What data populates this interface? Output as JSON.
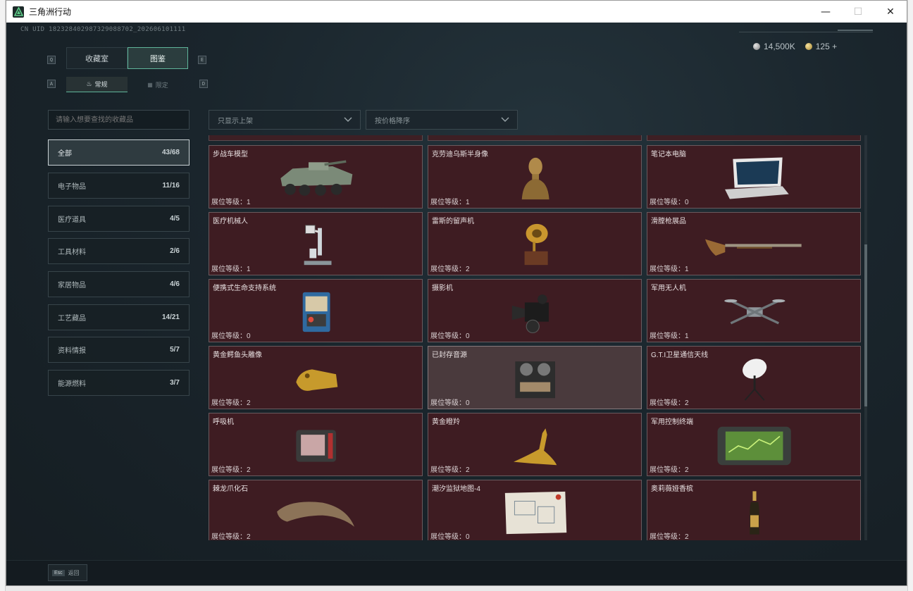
{
  "window": {
    "title": "三角洲行动"
  },
  "header": {
    "uid": "CN UID 182328402987329088702_202606101111",
    "currency": [
      {
        "icon": "silver-coin-icon",
        "value": "14,500K"
      },
      {
        "icon": "gold-coin-icon",
        "value": "125 +"
      }
    ]
  },
  "tabs": [
    {
      "label": "收藏室",
      "active": false
    },
    {
      "label": "图鉴",
      "active": true
    }
  ],
  "tab_keys": [
    "Q",
    "E"
  ],
  "subtabs": [
    {
      "label": "常规",
      "active": true
    },
    {
      "label": "限定",
      "active": false
    }
  ],
  "subtab_keys": [
    "A",
    "D"
  ],
  "search": {
    "placeholder": "请输入想要查找的收藏品"
  },
  "filters": [
    {
      "label": "只显示上架"
    },
    {
      "label": "按价格降序"
    }
  ],
  "categories": [
    {
      "name": "全部",
      "count": "43/68",
      "active": true
    },
    {
      "name": "电子物品",
      "count": "11/16"
    },
    {
      "name": "医疗道具",
      "count": "4/5"
    },
    {
      "name": "工具材料",
      "count": "2/6"
    },
    {
      "name": "家居物品",
      "count": "4/6"
    },
    {
      "name": "工艺藏品",
      "count": "14/21"
    },
    {
      "name": "资料情报",
      "count": "5/7"
    },
    {
      "name": "能源燃料",
      "count": "3/7"
    }
  ],
  "items": [
    {
      "name": "步战车模型",
      "level": "展位等级：1",
      "icon": "apc-model-icon"
    },
    {
      "name": "克劳迪乌斯半身像",
      "level": "展位等级：1",
      "icon": "bust-statue-icon"
    },
    {
      "name": "笔记本电脑",
      "level": "展位等级：0",
      "icon": "laptop-icon"
    },
    {
      "name": "医疗机械人",
      "level": "展位等级：1",
      "icon": "medical-robot-icon"
    },
    {
      "name": "雷斯的留声机",
      "level": "展位等级：2",
      "icon": "gramophone-icon"
    },
    {
      "name": "滑膛枪展品",
      "level": "展位等级：1",
      "icon": "musket-icon"
    },
    {
      "name": "便携式生命支持系统",
      "level": "展位等级：0",
      "icon": "life-support-icon"
    },
    {
      "name": "摄影机",
      "level": "展位等级：0",
      "icon": "camera-icon"
    },
    {
      "name": "军用无人机",
      "level": "展位等级：1",
      "icon": "drone-icon"
    },
    {
      "name": "黄金鳄鱼头雕像",
      "level": "展位等级：2",
      "icon": "golden-croc-head-icon"
    },
    {
      "name": "已封存音源",
      "level": "展位等级：0",
      "icon": "tape-recorder-icon",
      "selected": true
    },
    {
      "name": "G.T.I卫星通信天线",
      "level": "展位等级：2",
      "icon": "satellite-dish-icon"
    },
    {
      "name": "呼吸机",
      "level": "展位等级：2",
      "icon": "ventilator-icon"
    },
    {
      "name": "黄金瞪羚",
      "level": "展位等级：2",
      "icon": "golden-gazelle-icon"
    },
    {
      "name": "军用控制终端",
      "level": "展位等级：2",
      "icon": "control-terminal-icon"
    },
    {
      "name": "棘龙爪化石",
      "level": "展位等级：2",
      "icon": "claw-fossil-icon"
    },
    {
      "name": "潮汐监狱地图-4",
      "level": "展位等级：0",
      "icon": "prison-map-icon"
    },
    {
      "name": "奥莉薇娅香槟",
      "level": "展位等级：2",
      "icon": "champagne-icon"
    }
  ],
  "footer": {
    "esc_key": "Esc",
    "back_label": "返回"
  }
}
